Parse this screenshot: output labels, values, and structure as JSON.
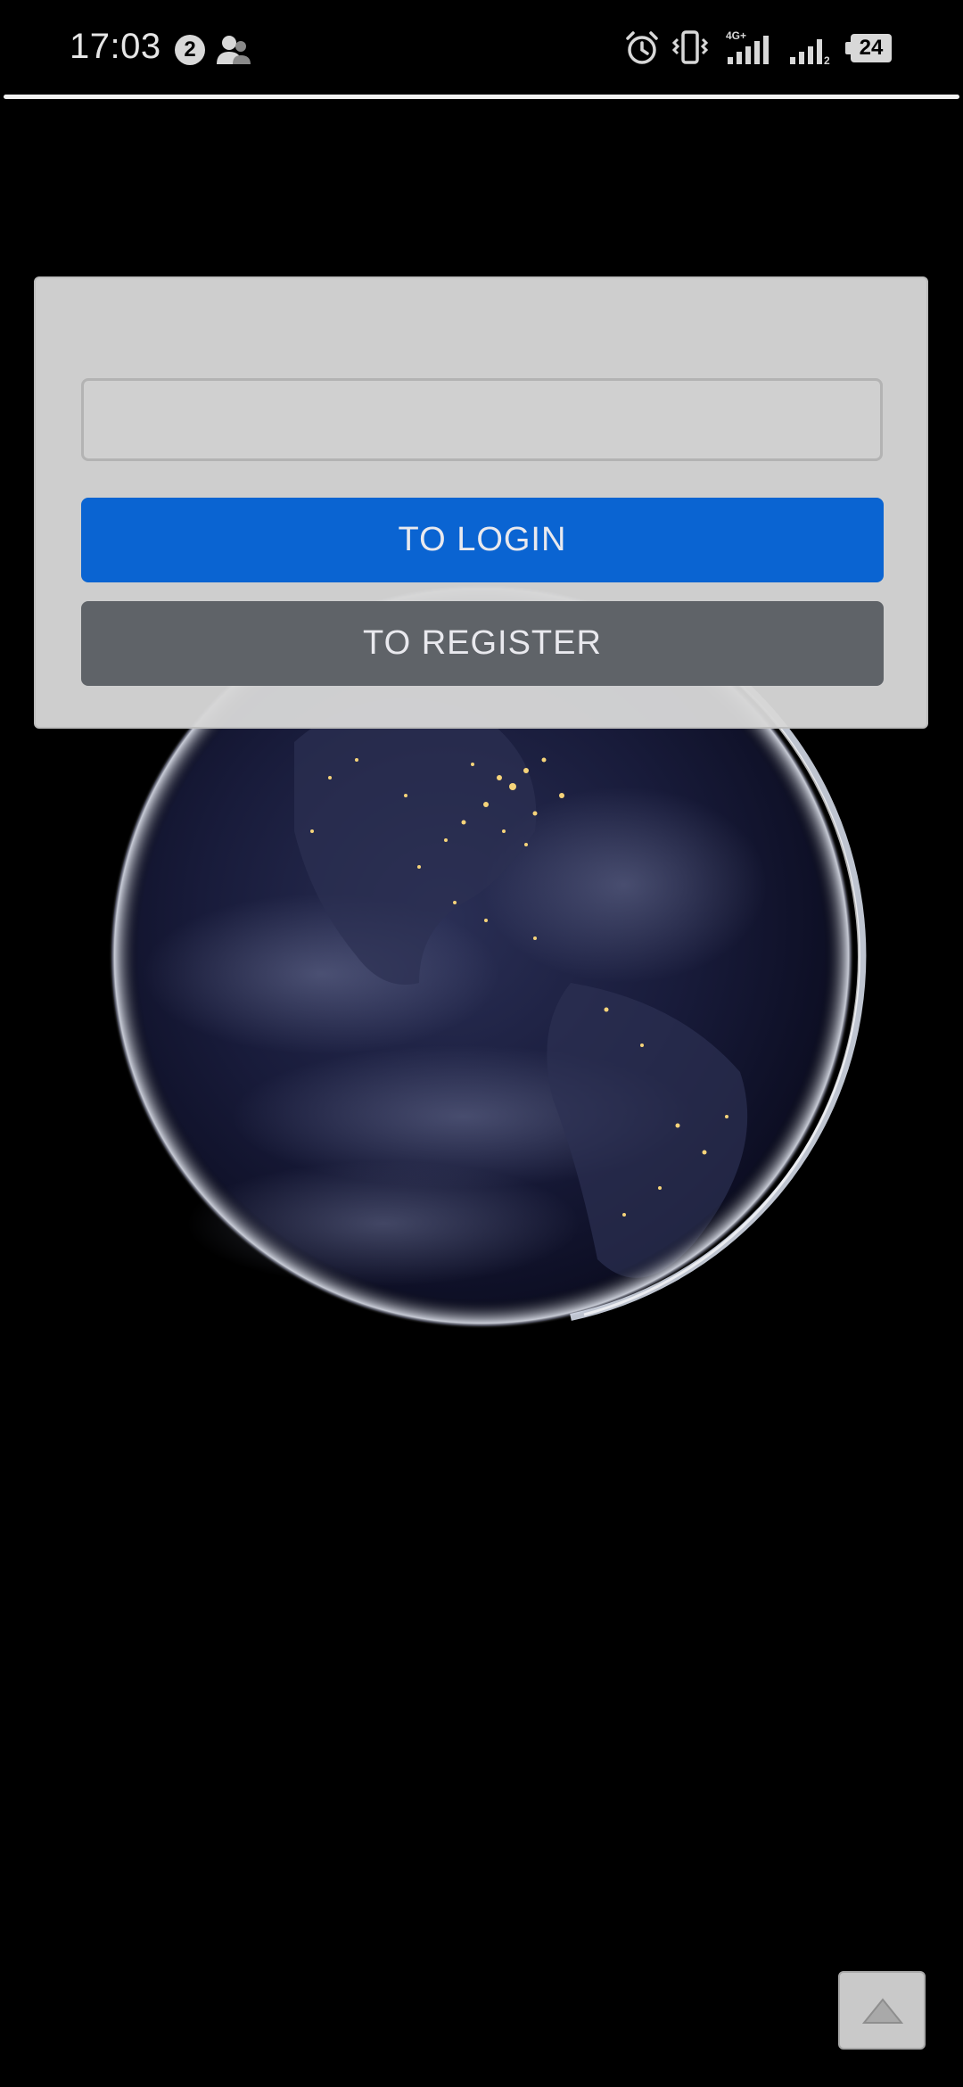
{
  "status_bar": {
    "time": "17:03",
    "notification_count": "2",
    "battery_level": "24",
    "network_label": "4G+",
    "sim2_label": "2"
  },
  "login_panel": {
    "input_value": "",
    "input_placeholder": "",
    "login_button_label": "TO LOGIN",
    "register_button_label": "TO REGISTER"
  },
  "colors": {
    "login_button": "#0a64d2",
    "register_button": "#5f6368",
    "panel_background": "#d6d6d6"
  },
  "icons": {
    "contact": "contact-icon",
    "alarm": "alarm-icon",
    "vibrate": "vibrate-icon",
    "signal_4g": "signal-4g-icon",
    "signal_sim2": "signal-sim2-icon",
    "battery": "battery-icon",
    "scroll_top": "chevron-up-icon"
  }
}
